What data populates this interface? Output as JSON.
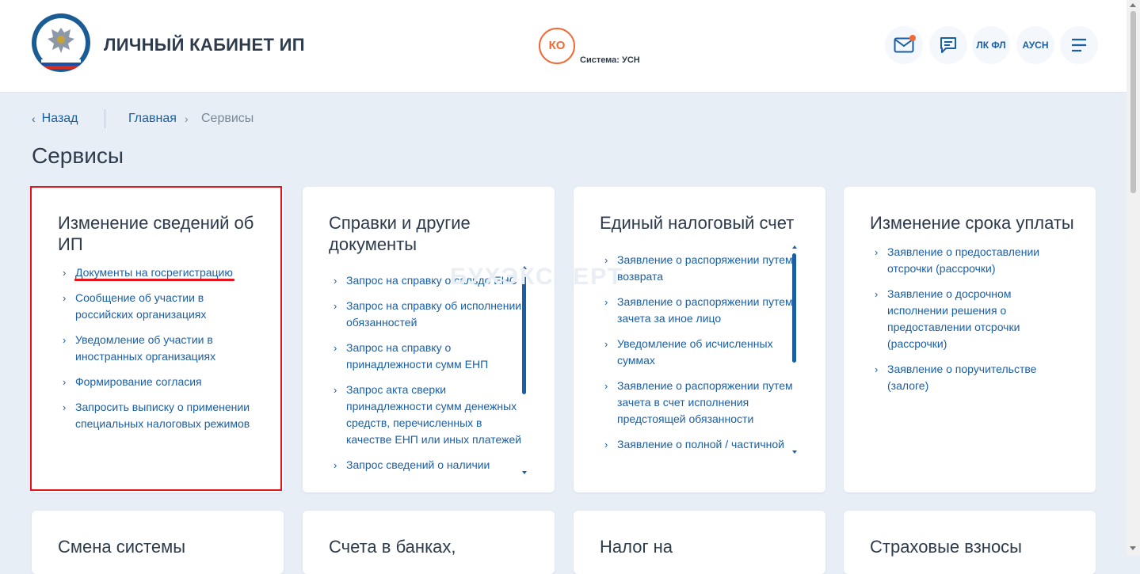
{
  "header": {
    "logo_alt": "ФНС",
    "title": "ЛИЧНЫЙ КАБИНЕТ ИП",
    "user_initials": "КО",
    "system_label": "Система: УСН",
    "buttons": {
      "lk_fl": "ЛК ФЛ",
      "ausn": "АУСН"
    }
  },
  "breadcrumb": {
    "back": "Назад",
    "home": "Главная",
    "separator": "›",
    "current": "Сервисы"
  },
  "page": {
    "title": "Сервисы"
  },
  "watermark": "БУХЭКСПЕРТ",
  "cards": [
    {
      "title": "Изменение сведений об ИП",
      "items": [
        "Документы на госрегистрацию",
        "Сообщение об участии в российских организациях",
        "Уведомление об участии в иностранных организациях",
        "Формирование согласия",
        "Запросить выписку о применении специальных налоговых режимов"
      ]
    },
    {
      "title": "Справки и другие документы",
      "items": [
        "Запрос на справку о сальдо ЕНС",
        "Запрос на справку об исполнении обязанностей",
        "Запрос на справку о принадлежности сумм ЕНП",
        "Запрос акта сверки принадлежности сумм денежных средств, перечисленных в качестве ЕНП или иных платежей",
        "Запрос сведений о наличии"
      ]
    },
    {
      "title": "Единый налоговый счет",
      "items": [
        "Заявление о распоряжении путем возврата",
        "Заявление о распоряжении путем зачета за иное лицо",
        "Уведомление об исчисленных суммах",
        "Заявление о распоряжении путем зачета в счет исполнения предстоящей обязанности",
        "Заявление о полной / частичной"
      ]
    },
    {
      "title": "Изменение срока уплаты",
      "items": [
        "Заявление о предоставлении отсрочки (рассрочки)",
        "Заявление о досрочном исполнении решения о предоставлении отсрочки (рассрочки)",
        "Заявление о поручительстве (залоге)"
      ]
    },
    {
      "title": "Смена системы",
      "items": []
    },
    {
      "title": "Счета в банках,",
      "items": []
    },
    {
      "title": "Налог на",
      "items": []
    },
    {
      "title": "Страховые взносы",
      "items": []
    }
  ],
  "colors": {
    "accent": "#1a5fa6",
    "orange": "#f06a35",
    "highlight": "#e3141c",
    "background": "#e8eef6"
  }
}
